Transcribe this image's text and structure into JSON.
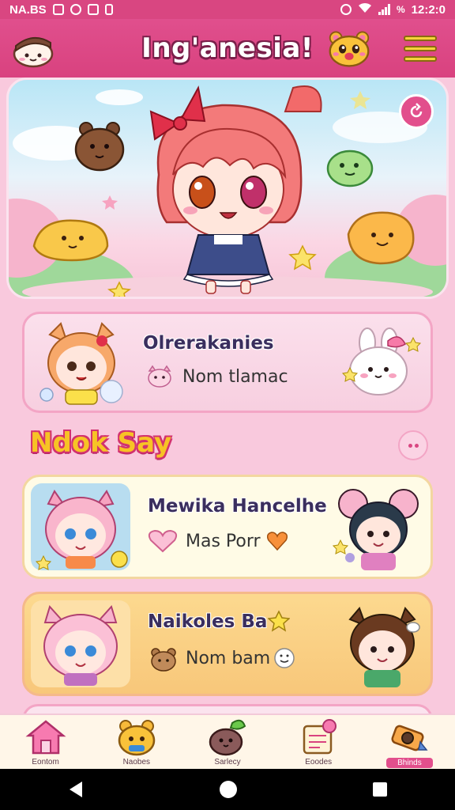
{
  "status_bar": {
    "left_text": "NA.BS",
    "time": "12:2:0",
    "battery_symbol": "%"
  },
  "header": {
    "title": "Ing'anesia!"
  },
  "featured_card": {
    "title": "Olrerakanies",
    "subtitle": "Nom tlamac"
  },
  "section": {
    "title": "Ndok Say"
  },
  "cards": [
    {
      "title": "Mewika Hancelhe",
      "subtitle": "Mas Porr"
    },
    {
      "title": "Naikoles Ba",
      "subtitle": "Nom bam"
    }
  ],
  "bottom_nav": [
    {
      "label": "Eontom",
      "icon": "home-icon"
    },
    {
      "label": "Naobes",
      "icon": "bear-icon"
    },
    {
      "label": "Sarlecy",
      "icon": "berry-icon"
    },
    {
      "label": "Eoodes",
      "icon": "notepad-icon"
    },
    {
      "label": "Bhinds",
      "icon": "camera-icon"
    }
  ],
  "colors": {
    "primary_pink": "#e24f8c",
    "header_pink": "#d9427f",
    "title_yellow": "#f7c325",
    "card_pink": "#fbe0ec",
    "card_cream": "#fffbe6",
    "card_orange": "#fcd98f"
  }
}
